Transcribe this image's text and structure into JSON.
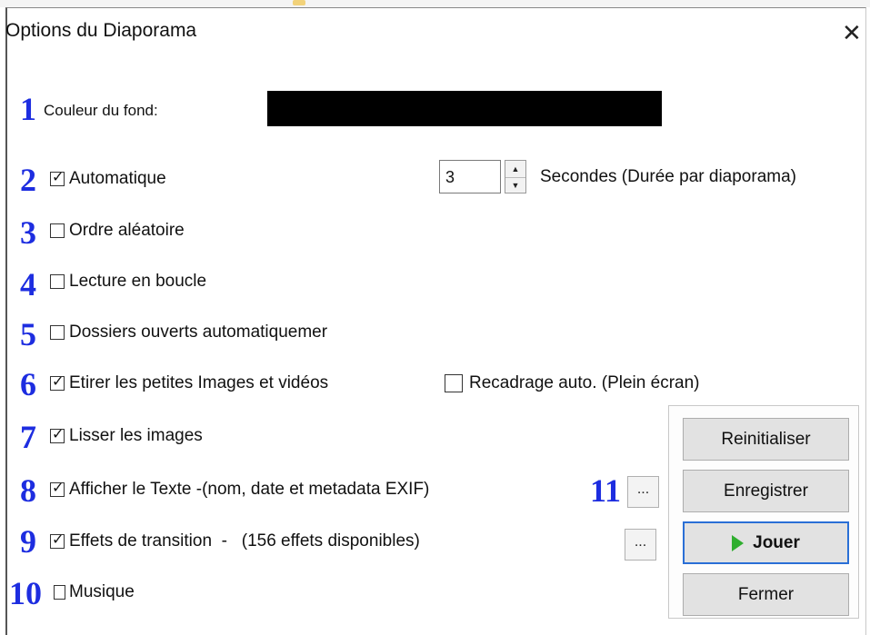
{
  "dialog": {
    "title": "Options du Diaporama",
    "close_glyph": "✕"
  },
  "numbers": [
    "1",
    "2",
    "3",
    "4",
    "5",
    "6",
    "7",
    "8",
    "9",
    "10",
    "11"
  ],
  "background_color": {
    "label": "Couleur du fond:",
    "value_hex": "#000000"
  },
  "options": [
    {
      "label": "Automatique",
      "checked": true
    },
    {
      "label": "Ordre aléatoire",
      "checked": false
    },
    {
      "label": "Lecture en boucle",
      "checked": false
    },
    {
      "label": "Dossiers ouverts automatiquemer",
      "checked": false
    },
    {
      "label": "Etirer les petites Images et vidéos",
      "checked": true
    },
    {
      "label": "Lisser les images",
      "checked": true
    },
    {
      "label": "Afficher le Texte -(nom, date et metadata EXIF)",
      "checked": true
    },
    {
      "label": "Effets de transition  -   (156 effets disponibles)",
      "checked": true
    },
    {
      "label": "Musique",
      "checked": false
    }
  ],
  "auto_crop": {
    "label": "Recadrage auto. (Plein écran)",
    "checked": false
  },
  "duration": {
    "value": "3",
    "suffix": "Secondes (Durée par diaporama)"
  },
  "ellipsis_button_label": "...",
  "buttons": {
    "reset": "Reinitialiser",
    "save": "Enregistrer",
    "play": "Jouer",
    "close": "Fermer"
  },
  "colors": {
    "accent_number": "#1d2de0",
    "play_icon": "#2fae2f",
    "default_border": "#2a6fd6"
  }
}
